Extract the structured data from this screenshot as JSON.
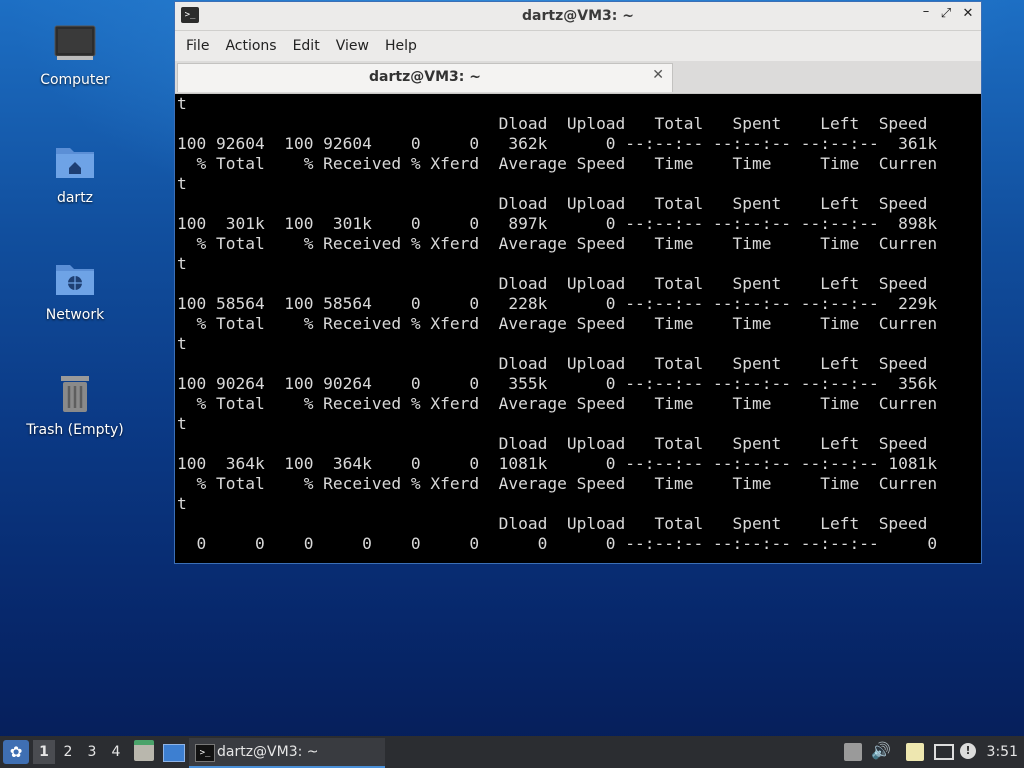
{
  "desktop": {
    "icons": [
      {
        "label": "Computer"
      },
      {
        "label": "dartz"
      },
      {
        "label": "Network"
      },
      {
        "label": "Trash (Empty)"
      }
    ]
  },
  "window": {
    "title": "dartz@VM3: ~",
    "menu": [
      "File",
      "Actions",
      "Edit",
      "View",
      "Help"
    ],
    "tab_label": "dartz@VM3: ~",
    "controls": {
      "minimize": "–",
      "maximize": "⤢",
      "close": "✕"
    }
  },
  "terminal": {
    "lines": [
      "t",
      "                                 Dload  Upload   Total   Spent    Left  Speed",
      "100 92604  100 92604    0     0   362k      0 --:--:-- --:--:-- --:--:--  361k",
      "  % Total    % Received % Xferd  Average Speed   Time    Time     Time  Curren",
      "t",
      "                                 Dload  Upload   Total   Spent    Left  Speed",
      "100  301k  100  301k    0     0   897k      0 --:--:-- --:--:-- --:--:--  898k",
      "  % Total    % Received % Xferd  Average Speed   Time    Time     Time  Curren",
      "t",
      "                                 Dload  Upload   Total   Spent    Left  Speed",
      "100 58564  100 58564    0     0   228k      0 --:--:-- --:--:-- --:--:--  229k",
      "  % Total    % Received % Xferd  Average Speed   Time    Time     Time  Curren",
      "t",
      "                                 Dload  Upload   Total   Spent    Left  Speed",
      "100 90264  100 90264    0     0   355k      0 --:--:-- --:--:-- --:--:--  356k",
      "  % Total    % Received % Xferd  Average Speed   Time    Time     Time  Curren",
      "t",
      "                                 Dload  Upload   Total   Spent    Left  Speed",
      "100  364k  100  364k    0     0  1081k      0 --:--:-- --:--:-- --:--:-- 1081k",
      "  % Total    % Received % Xferd  Average Speed   Time    Time     Time  Curren",
      "t",
      "                                 Dload  Upload   Total   Spent    Left  Speed",
      "  0     0    0     0    0     0      0      0 --:--:-- --:--:-- --:--:--     0"
    ]
  },
  "taskbar": {
    "workspaces": [
      "1",
      "2",
      "3",
      "4"
    ],
    "task_label": "dartz@VM3: ~",
    "clock": "3:51",
    "notify_glyph": "!"
  },
  "colors": {
    "terminal_bg": "#000000",
    "terminal_fg": "#d9d9d9",
    "accent": "#4a90d9"
  }
}
